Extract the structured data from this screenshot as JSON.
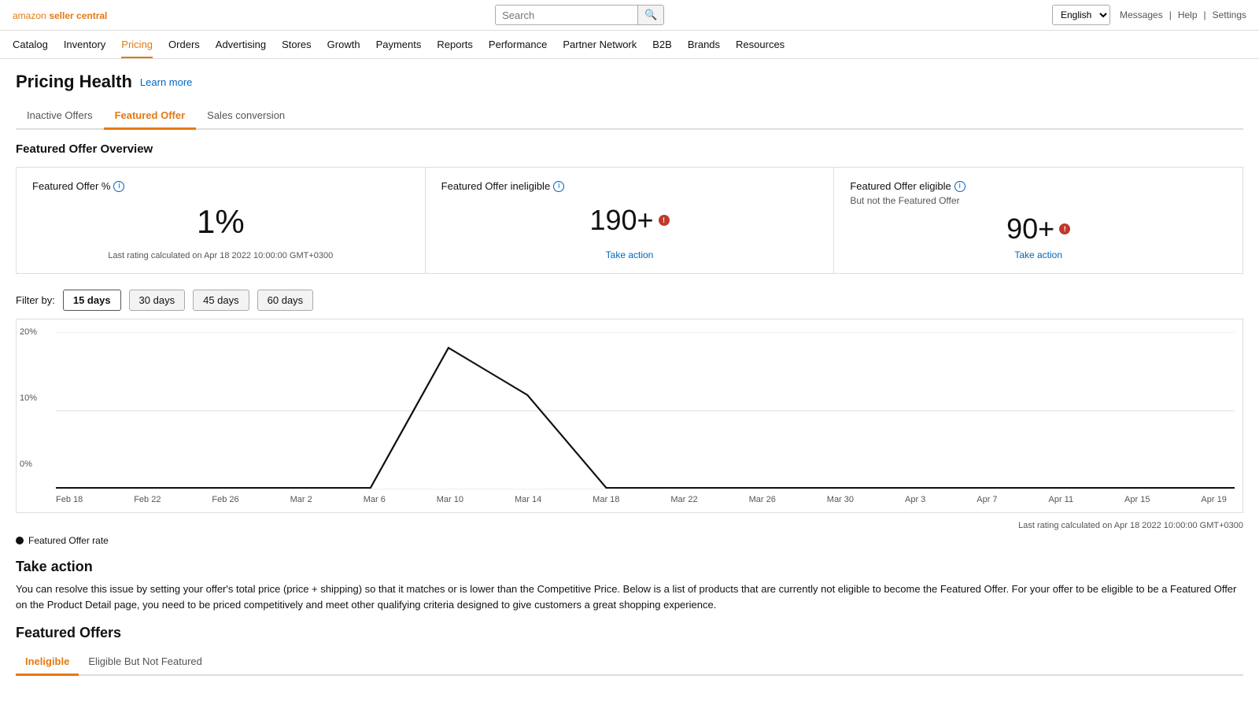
{
  "logo": {
    "text": "amazon seller central"
  },
  "topbar": {
    "search_placeholder": "Search",
    "search_button": "🔍",
    "language_options": [
      "English"
    ],
    "language_selected": "English",
    "links": [
      "Messages",
      "Help",
      "Settings"
    ]
  },
  "nav": {
    "items": [
      "Catalog",
      "Inventory",
      "Pricing",
      "Orders",
      "Advertising",
      "Stores",
      "Growth",
      "Payments",
      "Reports",
      "Performance",
      "Partner Network",
      "B2B",
      "Brands",
      "Resources"
    ]
  },
  "page": {
    "title": "Pricing Health",
    "learn_more": "Learn more"
  },
  "tabs": [
    {
      "label": "Inactive Offers",
      "active": false
    },
    {
      "label": "Featured Offer",
      "active": true
    },
    {
      "label": "Sales conversion",
      "active": false
    }
  ],
  "featured_offer_overview": {
    "section_title": "Featured Offer Overview",
    "cards": [
      {
        "title": "Featured Offer %",
        "has_info": true,
        "value": "1%",
        "subtitle": "",
        "rating_note": "Last rating calculated on Apr 18 2022 10:00:00 GMT+0300",
        "alert": false,
        "action": null
      },
      {
        "title": "Featured Offer ineligible",
        "has_info": true,
        "value": "190+",
        "subtitle": "",
        "rating_note": "",
        "alert": true,
        "action": "Take action"
      },
      {
        "title": "Featured Offer eligible",
        "subtitle": "But not the Featured Offer",
        "has_info": true,
        "value": "90+",
        "rating_note": "",
        "alert": true,
        "action": "Take action"
      }
    ]
  },
  "filter": {
    "label": "Filter by:",
    "options": [
      "15 days",
      "30 days",
      "45 days",
      "60 days"
    ],
    "active": "15 days"
  },
  "chart": {
    "note": "Last rating calculated on Apr 18 2022 10:00:00 GMT+0300",
    "y_labels": [
      "20%",
      "10%",
      "0%"
    ],
    "x_labels": [
      "Feb 18",
      "Feb 22",
      "Feb 26",
      "Mar 2",
      "Mar 6",
      "Mar 10",
      "Mar 14",
      "Mar 18",
      "Mar 22",
      "Mar 26",
      "Mar 30",
      "Apr 3",
      "Apr 7",
      "Apr 11",
      "Apr 15",
      "Apr 19"
    ],
    "legend": "Featured Offer rate"
  },
  "take_action": {
    "title": "Take action",
    "description": "You can resolve this issue by setting your offer's total price (price + shipping) so that it matches or is lower than the Competitive Price. Below is a list of products that are currently not eligible to become the Featured Offer. For your offer to be eligible to be a Featured Offer on the Product Detail page, you need to be priced competitively and meet other qualifying criteria designed to give customers a great shopping experience."
  },
  "featured_offers": {
    "title": "Featured Offers",
    "sub_tabs": [
      {
        "label": "Ineligible",
        "active": true
      },
      {
        "label": "Eligible But Not Featured",
        "active": false
      }
    ]
  }
}
